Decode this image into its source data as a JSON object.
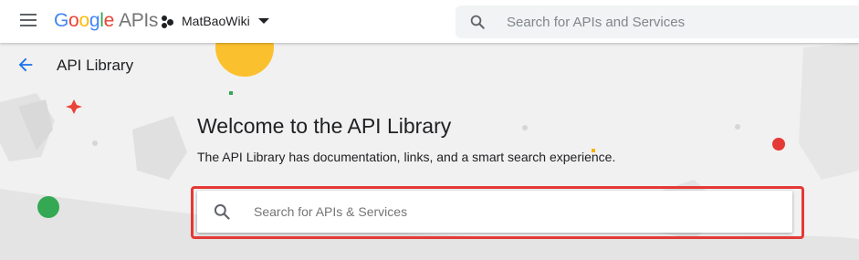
{
  "header": {
    "logo": {
      "letters": [
        "G",
        "o",
        "o",
        "g",
        "l",
        "e"
      ],
      "suffix": "APIs"
    },
    "project": {
      "name": "MatBaoWiki"
    },
    "search": {
      "placeholder": "Search for APIs and Services"
    }
  },
  "page": {
    "title": "API Library",
    "welcome_heading": "Welcome to the API Library",
    "subtitle": "The API Library has documentation, links, and a smart search experience.",
    "search": {
      "placeholder": "Search for APIs & Services"
    }
  },
  "icons": {
    "menu": "hamburger-menu-icon",
    "project": "project-icon",
    "dropdown": "caret-down-icon",
    "search": "search-icon",
    "back": "back-arrow-icon"
  },
  "colors": {
    "accent_blue": "#1a73e8",
    "highlight_red": "#e53935",
    "google_blue": "#4285f4",
    "google_red": "#ea4335",
    "google_yellow": "#fbbc05",
    "google_green": "#34a853"
  }
}
